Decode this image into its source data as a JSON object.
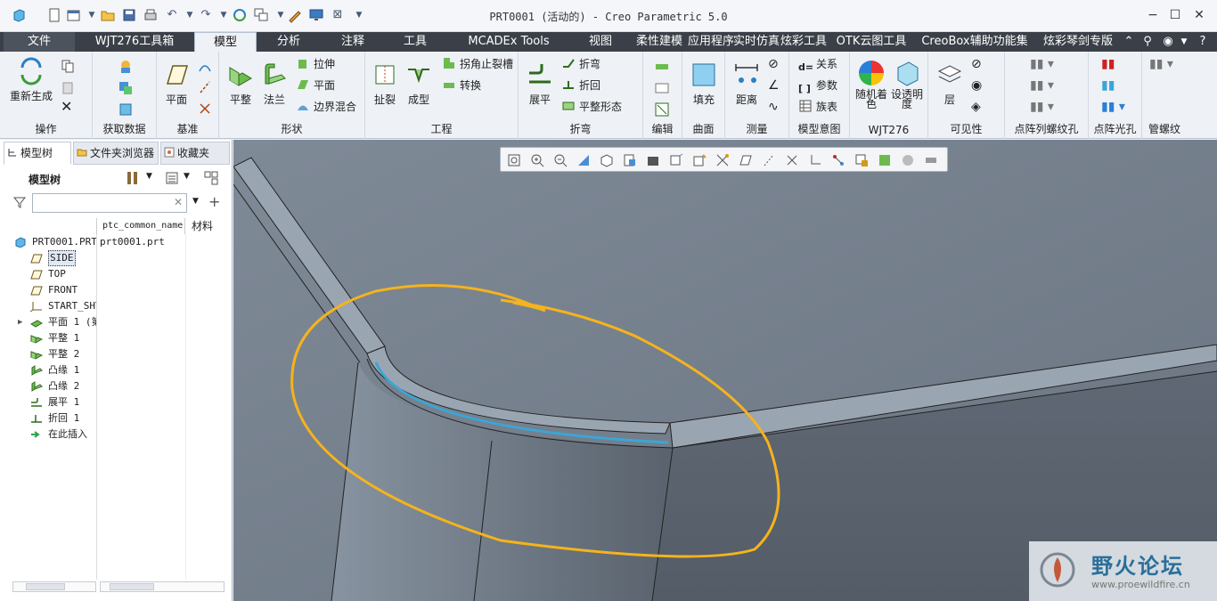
{
  "window": {
    "title": "PRT0001 (活动的) - Creo Parametric 5.0",
    "minimize_icon": "minimize-icon",
    "maximize_icon": "maximize-icon",
    "close_icon": "close-icon"
  },
  "tabs": [
    {
      "label": "文件"
    },
    {
      "label": "WJT276工具箱"
    },
    {
      "label": "模型"
    },
    {
      "label": "分析"
    },
    {
      "label": "注释"
    },
    {
      "label": "工具"
    },
    {
      "label": "MCADEx Tools"
    },
    {
      "label": "视图"
    },
    {
      "label": "柔性建模"
    },
    {
      "label": "应用程序"
    },
    {
      "label": "实时仿真"
    },
    {
      "label": "炫彩工具"
    },
    {
      "label": "OTK云图工具"
    },
    {
      "label": "CreoBox辅助功能集"
    },
    {
      "label": "炫彩琴剑专版"
    }
  ],
  "ribbon": {
    "operations": {
      "regenerate": "重新生成",
      "group": "操作"
    },
    "get_data": {
      "group": "获取数据"
    },
    "datum": {
      "plane": "平面",
      "group": "基准"
    },
    "shapes": {
      "flat": "平整",
      "flange": "法兰",
      "extrude": "拉伸",
      "planar": "平面",
      "blend": "边界混合",
      "group": "形状"
    },
    "engineering": {
      "rip": "扯裂",
      "form": "成型",
      "corner_relief": "拐角止裂槽",
      "convert": "转换",
      "group": "工程"
    },
    "bends": {
      "unbend": "展平",
      "bend": "折弯",
      "bend_back": "折回",
      "flat_state": "平整形态",
      "group": "折弯"
    },
    "editing": {
      "group": "编辑"
    },
    "surfaces": {
      "fill": "填充",
      "group": "曲面"
    },
    "measure": {
      "distance": "距离",
      "group": "测量"
    },
    "model_intent": {
      "relations": "关系",
      "parameters": "参数",
      "family_table": "族表",
      "group": "模型意图"
    },
    "wjt": {
      "random_color": "随机着色",
      "set_transparency": "设透明度",
      "group": "WJT276"
    },
    "visibility": {
      "layer": "层",
      "group": "可见性"
    },
    "thread_array": {
      "group": "点阵列螺纹孔"
    },
    "light_array": {
      "group": "点阵光孔"
    },
    "pipe_thread": {
      "group": "管螺纹"
    }
  },
  "left_panel": {
    "tabs": [
      "模型树",
      "文件夹浏览器",
      "收藏夹"
    ],
    "tree_title": "模型树",
    "filter_placeholder": "",
    "columns": [
      "ptc_common_name",
      "材料"
    ],
    "items": [
      {
        "name": "PRT0001.PRT",
        "col2": "prt0001.prt",
        "icon": "part-icon"
      },
      {
        "name": "SIDE",
        "col2": "",
        "icon": "datum-plane-icon"
      },
      {
        "name": "TOP",
        "col2": "",
        "icon": "datum-plane-icon"
      },
      {
        "name": "FRONT",
        "col2": "",
        "icon": "datum-plane-icon"
      },
      {
        "name": "START_SHT",
        "col2": "",
        "icon": "csys-icon"
      },
      {
        "name": "平面 1 (第",
        "col2": "",
        "icon": "flat-wall-icon"
      },
      {
        "name": "平整 1",
        "col2": "",
        "icon": "flat-icon"
      },
      {
        "name": "平整 2",
        "col2": "",
        "icon": "flat-icon"
      },
      {
        "name": "凸缘 1",
        "col2": "",
        "icon": "flange-icon"
      },
      {
        "name": "凸缘 2",
        "col2": "",
        "icon": "flange-icon"
      },
      {
        "name": "展平 1",
        "col2": "",
        "icon": "unbend-icon"
      },
      {
        "name": "折回 1",
        "col2": "",
        "icon": "bendback-icon"
      },
      {
        "name": "在此插入",
        "col2": "",
        "icon": "insert-arrow-icon"
      }
    ]
  },
  "watermark": {
    "title": "野火论坛",
    "url": "www.proewildfire.cn"
  },
  "colors": {
    "tab_bar": "#3b4048",
    "viewport_bg": "#5e6773",
    "annotation": "#f5b31c",
    "edge_highlight": "#3aa6d6"
  }
}
